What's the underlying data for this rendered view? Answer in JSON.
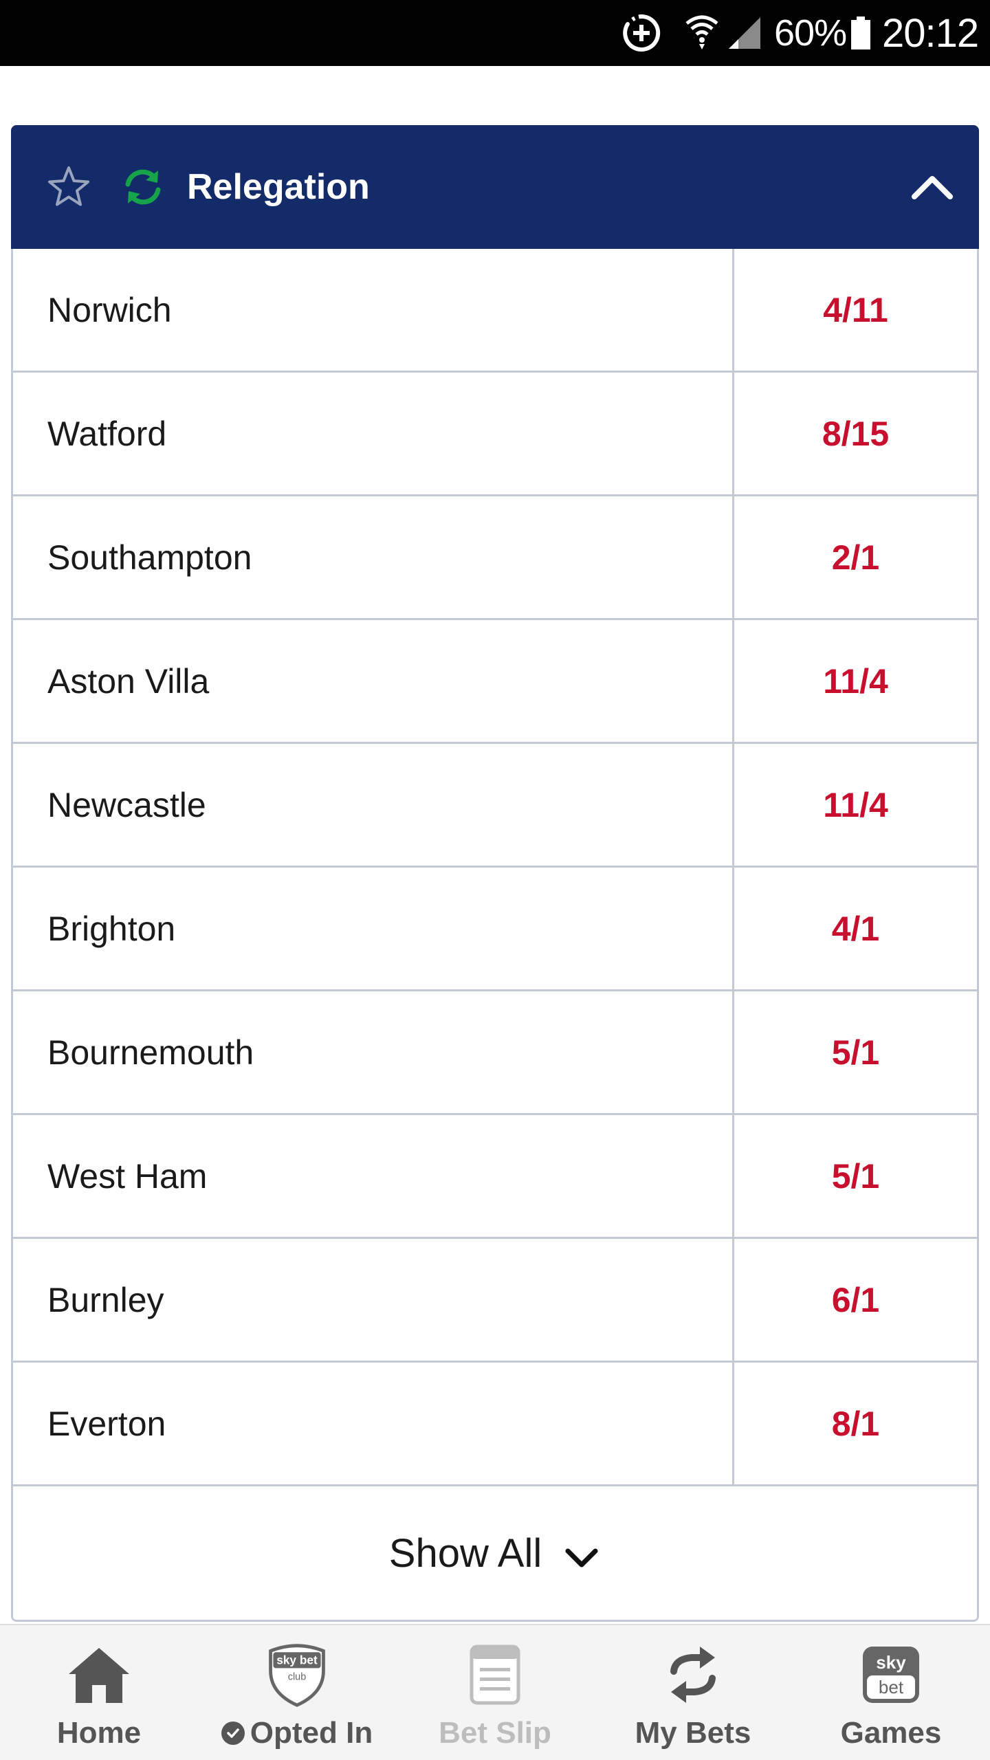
{
  "status_bar": {
    "battery": "60%",
    "time": "20:12",
    "icons": [
      "data-saver-icon",
      "wifi-icon",
      "signal-icon",
      "battery-icon"
    ]
  },
  "market": {
    "title": "Relegation",
    "colors": {
      "header_bg": "#142b6a",
      "odds": "#c8102e",
      "refresh": "#17a34a"
    },
    "rows": [
      {
        "team": "Norwich",
        "odds": "4/11"
      },
      {
        "team": "Watford",
        "odds": "8/15"
      },
      {
        "team": "Southampton",
        "odds": "2/1"
      },
      {
        "team": "Aston Villa",
        "odds": "11/4"
      },
      {
        "team": "Newcastle",
        "odds": "11/4"
      },
      {
        "team": "Brighton",
        "odds": "4/1"
      },
      {
        "team": "Bournemouth",
        "odds": "5/1"
      },
      {
        "team": "West Ham",
        "odds": "5/1"
      },
      {
        "team": "Burnley",
        "odds": "6/1"
      },
      {
        "team": "Everton",
        "odds": "8/1"
      }
    ],
    "show_all_label": "Show All"
  },
  "bottom_nav": {
    "items": [
      {
        "label": "Home",
        "icon": "home-icon"
      },
      {
        "label": "Opted In",
        "icon": "sky-bet-club-icon",
        "logo_text": "sky bet",
        "logo_sub": "club"
      },
      {
        "label": "Bet Slip",
        "icon": "bet-slip-icon",
        "disabled": true
      },
      {
        "label": "My Bets",
        "icon": "my-bets-icon"
      },
      {
        "label": "Games",
        "icon": "sky-bet-games-icon",
        "logo_top": "sky",
        "logo_bottom": "bet"
      }
    ]
  }
}
